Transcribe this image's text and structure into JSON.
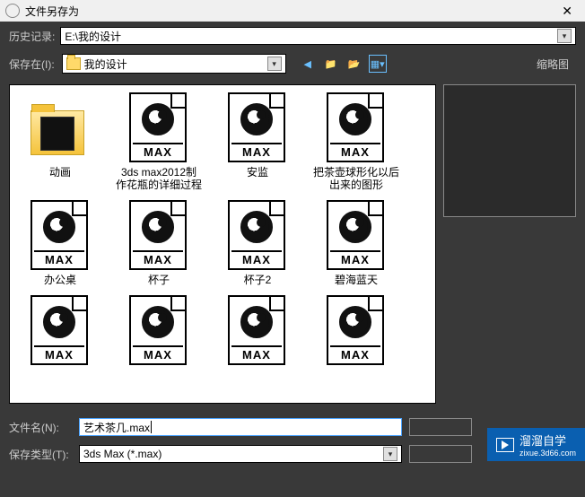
{
  "window": {
    "title": "文件另存为",
    "close_label": "✕"
  },
  "history": {
    "label": "历史记录:",
    "value": "E:\\我的设计"
  },
  "savein": {
    "label": "保存在(I):",
    "value": "我的设计"
  },
  "thumbnail_label": "缩略图",
  "files": [
    {
      "name": "动画",
      "type": "folder"
    },
    {
      "name": "3ds max2012制作花瓶的详细过程",
      "type": "max"
    },
    {
      "name": "安监",
      "type": "max"
    },
    {
      "name": "把茶壶球形化以后出来的图形",
      "type": "max"
    },
    {
      "name": "办公桌",
      "type": "max"
    },
    {
      "name": "杯子",
      "type": "max"
    },
    {
      "name": "杯子2",
      "type": "max"
    },
    {
      "name": "碧海蓝天",
      "type": "max"
    },
    {
      "name": "",
      "type": "max"
    },
    {
      "name": "",
      "type": "max"
    },
    {
      "name": "",
      "type": "max"
    },
    {
      "name": "",
      "type": "max"
    }
  ],
  "max_icon_label": "MAX",
  "filename": {
    "label": "文件名(N):",
    "value": "艺术茶几.max"
  },
  "filetype": {
    "label": "保存类型(T):",
    "value": "3ds Max (*.max)"
  },
  "watermark": {
    "brand": "溜溜自学",
    "url": "zixue.3d66.com"
  }
}
